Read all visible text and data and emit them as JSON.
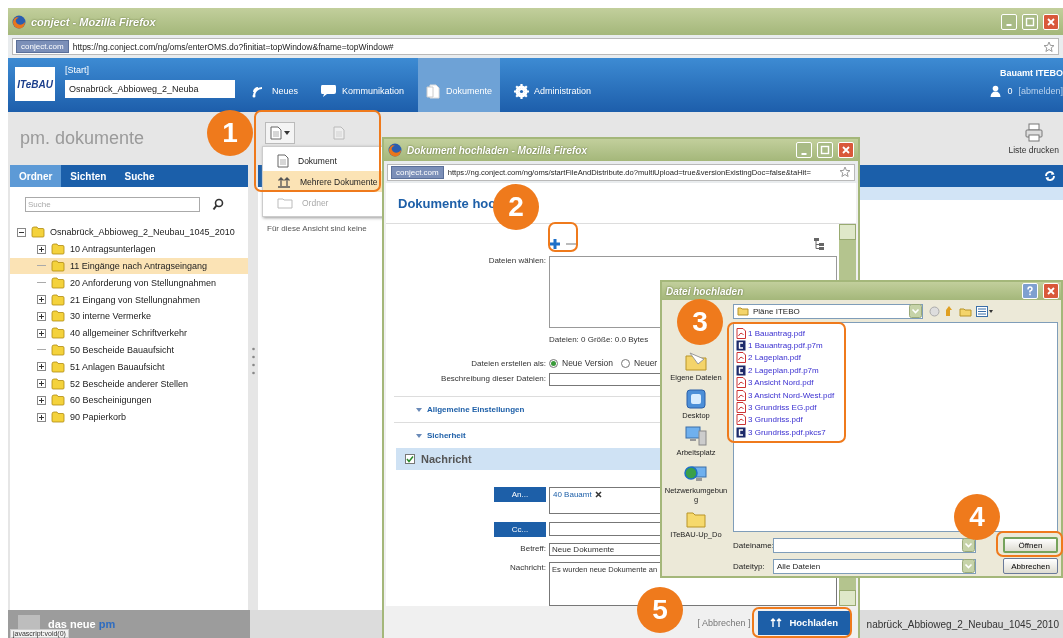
{
  "browser": {
    "title": "conject - Mozilla Firefox",
    "site_badge": "conject.com",
    "url": "https://ng.conject.com/ng/oms/enterOMS.do?finitiat=topWindow&fname=topWindow#"
  },
  "header": {
    "logo": "ITeBAU",
    "breadcrumb": "[Start]",
    "project": "Osnabrück_Abbioweg_2_Neuba",
    "nav": [
      {
        "label": "Neues",
        "selected": false
      },
      {
        "label": "Kommunikation",
        "selected": false
      },
      {
        "label": "Dokumente",
        "selected": true
      },
      {
        "label": "Administration",
        "selected": false
      }
    ],
    "account": "Bauamt ITEBO",
    "user_count": "0",
    "logout": "[abmelden]"
  },
  "left_panel": {
    "title": "pm. dokumente",
    "tabs": [
      {
        "label": "Ordner",
        "selected": true
      },
      {
        "label": "Sichten",
        "selected": false
      },
      {
        "label": "Suche",
        "selected": false
      }
    ],
    "search": {
      "placeholder": "Suche"
    },
    "tree": {
      "label": "Osnabrück_Abbioweg_2_Neubau_1045_2010",
      "expanded": true,
      "selected": false,
      "children": [
        {
          "label": "10 Antragsunterlagen",
          "expandable": true,
          "selected": false
        },
        {
          "label": "11 Eingänge nach Antragseingang",
          "expandable": false,
          "selected": true
        },
        {
          "label": "20 Anforderung von Stellungnahmen",
          "expandable": false,
          "selected": false
        },
        {
          "label": "21 Eingang von Stellungnahmen",
          "expandable": true,
          "selected": false
        },
        {
          "label": "30 interne Vermerke",
          "expandable": true,
          "selected": false
        },
        {
          "label": "40 allgemeiner Schriftverkehr",
          "expandable": true,
          "selected": false
        },
        {
          "label": "50 Bescheide Bauaufsicht",
          "expandable": false,
          "selected": false
        },
        {
          "label": "51 Anlagen Bauaufsicht",
          "expandable": true,
          "selected": false
        },
        {
          "label": "52 Bescheide anderer Stellen",
          "expandable": true,
          "selected": false
        },
        {
          "label": "60 Bescheinigungen",
          "expandable": true,
          "selected": false
        },
        {
          "label": "90 Papierkorb",
          "expandable": true,
          "selected": false
        }
      ]
    }
  },
  "toolbar": {
    "new_menu": [
      {
        "label": "Dokument",
        "selected": false,
        "disabled": false
      },
      {
        "label": "Mehrere Dokumente",
        "selected": true,
        "disabled": false
      },
      {
        "label": "Ordner",
        "selected": false,
        "disabled": true
      }
    ],
    "empty_note": "Für diese Ansicht sind keine",
    "print_button": "Liste drucken"
  },
  "footer": {
    "tagline": "das neue",
    "brand": "pm",
    "breadcrumb": "nabrück_Abbioweg_2_Neubau_1045_2010",
    "status_text": "javascript:void(0)"
  },
  "upload_window": {
    "title": "Dokument hochladen - Mozilla Firefox",
    "site_badge": "conject.com",
    "url": "https://ng.conject.com/ng/oms/startFileAndDistribute.do?multiUpload=true&versionExistingDoc=false&taHit=",
    "heading": "Dokumente hoc",
    "files_label": "Dateien wählen:",
    "files_summary": "Dateien: 0 Größe: 0.0 Bytes",
    "create_as_label": "Dateien erstellen als:",
    "create_as_options": [
      {
        "label": "Neue Version",
        "selected": true
      },
      {
        "label": "Neuer",
        "selected": false
      }
    ],
    "description_label": "Beschreibung dieser Dateien:",
    "sections": [
      "Allgemeine Einstellungen",
      "Sicherheit"
    ],
    "message": {
      "label": "Nachricht",
      "checked": true,
      "to_button": "An...",
      "recipients": [
        "40 Bauamt"
      ],
      "cc_button": "Cc...",
      "subject_label": "Betreff:",
      "subject": "Neue Dokumente",
      "body_label": "Nachricht:",
      "body": "Es wurden neue Dokumente an"
    },
    "cancel": "[ Abbrechen ]",
    "upload_button": "Hochladen"
  },
  "file_dialog": {
    "title": "Datei hochladen",
    "look_in": "Pläne ITEBO",
    "places": [
      "Eigene Dateien",
      "Desktop",
      "Arbeitsplatz",
      "Netzwerkumgebung",
      "ITeBAU-Up_Do"
    ],
    "files": [
      {
        "name": "1 Bauantrag.pdf",
        "kind": "pdf"
      },
      {
        "name": "1 Bauantrag.pdf.p7m",
        "kind": "signed"
      },
      {
        "name": "2 Lageplan.pdf",
        "kind": "pdf"
      },
      {
        "name": "2 Lageplan.pdf.p7m",
        "kind": "signed"
      },
      {
        "name": "3 Ansicht Nord.pdf",
        "kind": "pdf"
      },
      {
        "name": "3 Ansicht Nord-West.pdf",
        "kind": "pdf"
      },
      {
        "name": "3 Grundriss EG.pdf",
        "kind": "pdf"
      },
      {
        "name": "3 Grundriss.pdf",
        "kind": "pdf"
      },
      {
        "name": "3 Grundriss.pdf.pkcs7",
        "kind": "signed"
      }
    ],
    "filename_label": "Dateiname:",
    "filetype_label": "Dateityp:",
    "filetype": "Alle Dateien",
    "open_button": "Öffnen",
    "cancel_button": "Abbrechen"
  },
  "callouts": [
    "1",
    "2",
    "3",
    "4",
    "5"
  ]
}
